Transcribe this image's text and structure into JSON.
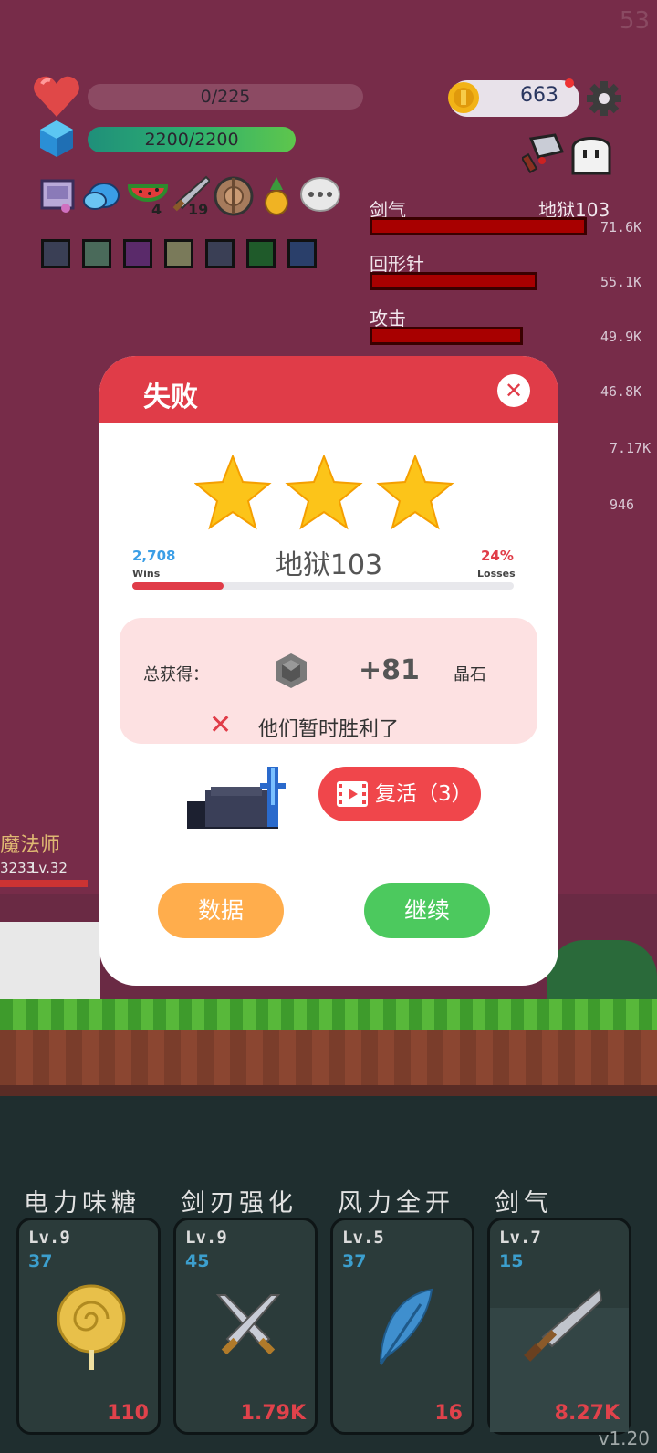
{
  "hud": {
    "fps": "53",
    "hp_text": "0/225",
    "mp_text": "2200/2200",
    "coins": "663",
    "inventory": [
      {
        "name": "watermelon-icon",
        "count": "4"
      },
      {
        "name": "sword-item-icon",
        "count": "19"
      }
    ],
    "chat_dots": "..."
  },
  "damage": {
    "stage_label": "地狱103",
    "rows": [
      {
        "label": "剑气",
        "value": "71.6K",
        "fill": 1.0
      },
      {
        "label": "回形针",
        "value": "55.1K",
        "fill": 0.77
      },
      {
        "label": "攻击",
        "value": "49.9K",
        "fill": 0.7
      },
      {
        "label": "",
        "value": "46.8K"
      },
      {
        "label": "",
        "value": "7.17K"
      },
      {
        "label": "",
        "value": "946"
      }
    ]
  },
  "modal": {
    "title": "失败",
    "close": "✕",
    "stars": 3,
    "wins_value": "2,708",
    "wins_label": "Wins",
    "stage": "地狱103",
    "losses_value": "24%",
    "losses_label": "Losses",
    "loss_fraction": 0.24,
    "reward_label": "总获得：",
    "reward_amount": "+81",
    "reward_unit": "晶石",
    "status": "他们暂时胜利了",
    "revive_label": "复活（3）",
    "data_button": "数据",
    "continue_button": "继续"
  },
  "enemy": {
    "name": "魔法师",
    "hp": "3233",
    "level": "Lv.32"
  },
  "skills": [
    {
      "name": "电力味糖",
      "level": "Lv.9",
      "num": "37",
      "cost": "110",
      "icon": "lollipop-icon"
    },
    {
      "name": "剑刃强化",
      "level": "Lv.9",
      "num": "45",
      "cost": "1.79K",
      "icon": "crossed-swords-icon"
    },
    {
      "name": "风力全开",
      "level": "Lv.5",
      "num": "37",
      "cost": "16",
      "icon": "feather-icon"
    },
    {
      "name": "剑气",
      "level": "Lv.7",
      "num": "15",
      "cost": "8.27K",
      "icon": "sword-icon"
    }
  ],
  "version": "v1.20",
  "colors": {
    "accent": "#e03c48",
    "bg": "#772c49",
    "orange": "#ffad4c",
    "green": "#4cc95e"
  }
}
